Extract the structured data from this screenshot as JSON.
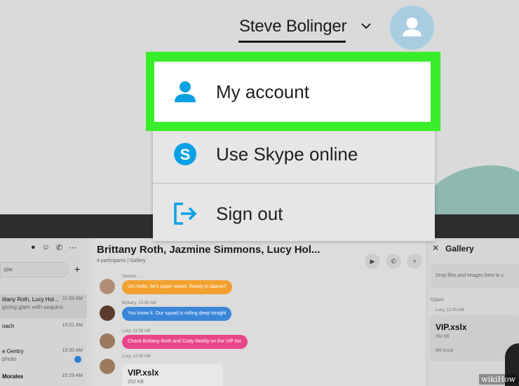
{
  "header": {
    "user_name": "Steve Bolinger",
    "chevron_icon": "chevron-down-icon",
    "avatar_icon": "user-icon"
  },
  "menu": {
    "items": [
      {
        "label": "My account",
        "icon": "person-icon",
        "highlighted": true
      },
      {
        "label": "Use Skype online",
        "icon": "skype-icon"
      },
      {
        "label": "Sign out",
        "icon": "sign-out-icon"
      }
    ]
  },
  "colors": {
    "highlight": "#38ee2a",
    "icon_blue": "#0ba1e4",
    "avatar": "#a9cde1"
  },
  "sidebar": {
    "search_placeholder": "ype",
    "rows": [
      {
        "name": "ittany Roth, Lucy Hol...",
        "preview": "giving glam with sequins.",
        "time": "11:08 AM"
      },
      {
        "name": "oach",
        "preview": "",
        "time": "10:31 AM"
      },
      {
        "name": "e Gentry",
        "preview": "photo",
        "time": "10:30 AM"
      },
      {
        "name": "Morales",
        "preview": "",
        "time": "10:29 AM"
      }
    ]
  },
  "chat": {
    "title": "Brittany Roth, Jazmine Simmons, Lucy Hol...",
    "subtitle": "4 participants  |  Gallery",
    "messages": [
      {
        "meta": "Serena, ...",
        "text": "Um hello, he's super sweet. Ready to dance?",
        "color": "#f2a12e"
      },
      {
        "meta": "Brittany, 10:58 AM",
        "text": "You know it. Our squad is rolling deep tonight",
        "color": "#3a86d8"
      },
      {
        "meta": "Lucy, 11:08 AM",
        "text": "Check Brittany Roth and Cody Reddy on the VIP list.",
        "color": "#e8458a"
      },
      {
        "meta": "Lucy, 11:00 AM",
        "text": "",
        "color": ""
      }
    ],
    "file": {
      "name": "VIP.xslx",
      "size": "252 KB"
    }
  },
  "gallery": {
    "title": "Gallery",
    "drop_text": "Drop files and images here to s",
    "today": "TODAY",
    "meta": "Lucy, 11:00 AM",
    "file": {
      "name": "VIP.xslx",
      "size": "252 KB",
      "type": "MS Excel"
    }
  },
  "watermark": "wikiHow"
}
